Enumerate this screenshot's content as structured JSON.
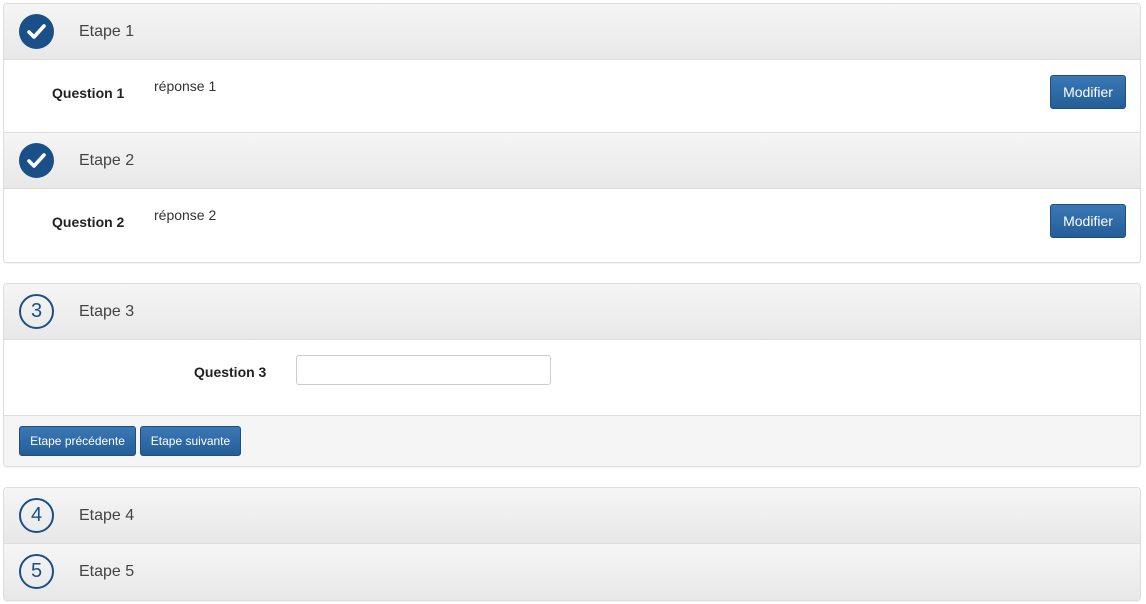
{
  "colors": {
    "primary": "#1a4f87",
    "button": "#2d6aa6",
    "header_bg": "#efefef"
  },
  "steps": [
    {
      "title": "Etape 1",
      "status": "done",
      "icon": "check-icon"
    },
    {
      "title": "Etape 2",
      "status": "done",
      "icon": "check-icon"
    },
    {
      "title": "Etape 3",
      "status": "current",
      "number": "3"
    },
    {
      "title": "Etape 4",
      "status": "pending",
      "number": "4"
    },
    {
      "title": "Etape 5",
      "status": "pending",
      "number": "5"
    }
  ],
  "answers": [
    {
      "question": "Question 1",
      "answer": "réponse 1",
      "edit_label": "Modifier"
    },
    {
      "question": "Question 2",
      "answer": "réponse 2",
      "edit_label": "Modifier"
    }
  ],
  "current": {
    "question": "Question 3",
    "input_value": "",
    "prev_label": "Etape précédente",
    "next_label": "Etape suivante"
  }
}
